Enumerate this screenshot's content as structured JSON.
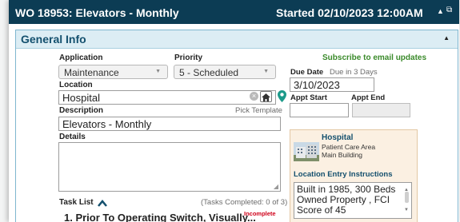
{
  "header": {
    "title": "WO 18953: Elevators - Monthly",
    "started": "Started 02/10/2023 12:00AM",
    "collapse_icon": "caret-up-icon",
    "popout_icon": "popout-icon"
  },
  "section": {
    "title": "General Info"
  },
  "form": {
    "application_label": "Application",
    "application_value": "Maintenance",
    "priority_label": "Priority",
    "priority_value": "5 - Scheduled",
    "location_label": "Location",
    "location_value": "Hospital",
    "description_label": "Description",
    "pick_template": "Pick Template",
    "description_value": "Elevators - Monthly",
    "details_label": "Details",
    "details_value": ""
  },
  "schedule": {
    "subscribe_link": "Subscribe to email updates",
    "due_date_label": "Due Date",
    "due_in": "Due in 3 Days",
    "due_date_value": "3/10/2023",
    "appt_start_label": "Appt Start",
    "appt_end_label": "Appt End",
    "appt_start_value": "",
    "appt_end_value": ""
  },
  "location_card": {
    "name": "Hospital",
    "area": "Patient Care Area",
    "building": "Main Building",
    "instructions_label": "Location Entry Instructions",
    "instructions_text": "Built in 1985, 300 Beds Owned Property , FCI Score of 45"
  },
  "tasks": {
    "label": "Task List",
    "completed": "(Tasks Completed: 0 of 3)",
    "item1": "1. Prior To Operating Switch, Visually...",
    "item1_status": "Incomplete"
  },
  "colors": {
    "titlebar": "#0c3c54",
    "section_header": "#dcedf4",
    "link_green": "#3a8a2a",
    "incomplete_red": "#d0021b",
    "location_pin": "#1c9a8a"
  }
}
